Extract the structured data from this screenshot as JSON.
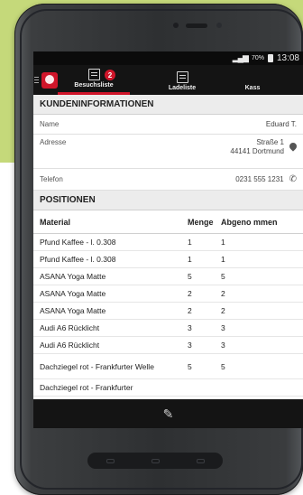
{
  "statusbar": {
    "battery_pct": "70%",
    "time": "13:08"
  },
  "appbar": {
    "tabs": [
      {
        "label": "Besuchsliste",
        "badge": "2"
      },
      {
        "label": "Ladeliste"
      },
      {
        "label": "Kass"
      }
    ]
  },
  "customer": {
    "heading": "KUNDENINFORMATIONEN",
    "name_label": "Name",
    "name_value": "Eduard T.",
    "address_label": "Adresse",
    "address_line1": "Straße 1",
    "address_line2": "44141 Dortmund",
    "phone_label": "Telefon",
    "phone_value": "0231 555 1231"
  },
  "positions": {
    "heading": "POSITIONEN",
    "columns": {
      "material": "Material",
      "menge": "Menge",
      "abgenommen": "Abgeno mmen"
    },
    "rows": [
      {
        "material": "Pfund Kaffee - l. 0.308",
        "menge": "1",
        "abgenommen": "1"
      },
      {
        "material": "Pfund Kaffee - l. 0.308",
        "menge": "1",
        "abgenommen": "1"
      },
      {
        "material": "ASANA Yoga Matte",
        "menge": "5",
        "abgenommen": "5"
      },
      {
        "material": "ASANA Yoga Matte",
        "menge": "2",
        "abgenommen": "2"
      },
      {
        "material": "ASANA Yoga Matte",
        "menge": "2",
        "abgenommen": "2"
      },
      {
        "material": "Audi A6 Rücklicht",
        "menge": "3",
        "abgenommen": "3"
      },
      {
        "material": "Audi A6 Rücklicht",
        "menge": "3",
        "abgenommen": "3"
      },
      {
        "material": "Dachziegel rot - Frankfurter Welle",
        "menge": "5",
        "abgenommen": "5"
      },
      {
        "material": "Dachziegel rot - Frankfurter",
        "menge": "",
        "abgenommen": ""
      }
    ]
  },
  "colors": {
    "accent": "#d0152a",
    "background_accent": "#c5d97a",
    "bar": "#141414"
  },
  "icons": [
    "menu-icon",
    "app-logo",
    "list-icon",
    "list-icon",
    "location-pin-icon",
    "phone-icon",
    "pencil-icon"
  ]
}
